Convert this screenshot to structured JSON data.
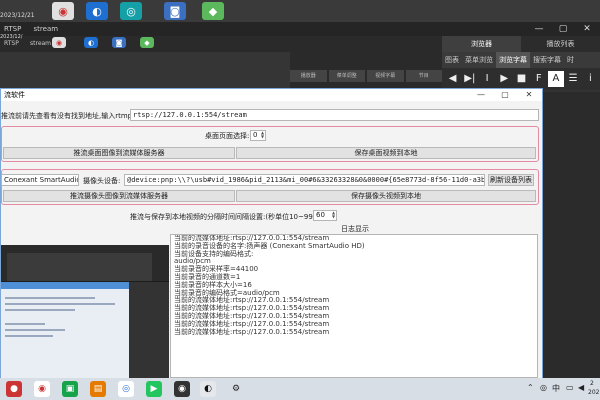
{
  "background": {
    "top_clock": "2023/12/21",
    "top_tabs": [
      "RTSP",
      "stream"
    ],
    "window2_tabs": [
      "RTSP",
      "stream"
    ],
    "window2_clock": "2023/12/",
    "bg2_tabs": [
      "播放器",
      "菜单调整",
      "视频字幕",
      "节目"
    ]
  },
  "player_panel": {
    "tabs": [
      "浏览器",
      "播放列表"
    ],
    "subtabs": [
      "图表",
      "菜单浏览",
      "浏览字幕",
      "搜索字幕",
      "时"
    ],
    "controls": [
      "◀",
      "▶|",
      "I",
      "▶",
      "■",
      "F",
      "A",
      "☰",
      "i"
    ]
  },
  "app": {
    "title": "流软件",
    "url_label": "推流前请先查看有没有找到地址,输入rtmp即可推(推)",
    "url_value": "rtsp://127.0.0.1:554/stream",
    "desktop_label": "桌面页面选择:",
    "desktop_value": "0",
    "btn_push_desktop": "推流桌面图像到流媒体服务器",
    "btn_save_desktop": "保存桌面视频到本地",
    "audio_label": "Conexant SmartAudio HD",
    "camera_label": "摄像头设备:",
    "camera_value": "@device:pnp:\\\\?\\usb#vid_1986&pid_2113&mi_00#6&33263328&0&0000#{65e8773d-8f56-11d0-a3b9-00a0c9223196}\\global",
    "btn_refresh": "刷新设备列表",
    "btn_push_camera": "推流摄像头图像到流媒体服务器",
    "btn_save_camera": "保存摄像头视频到本地",
    "interval_label": "推流与保存到本地视频的分隔时间间隔设置:(秒单位10~9999)",
    "interval_value": "60",
    "log_title": "日志显示",
    "log_lines": [
      "当前的流媒体地址:rtsp://127.0.0.1:554/stream",
      "当前的录音设备的名字:扬声器 (Conexant SmartAudio HD)",
      "当前设备支持的编码格式:",
      "audio/pcm",
      "当前录音的采样率=44100",
      "当前录音的通道数=1",
      "当前录音的样本大小=16",
      "当前录音的编码格式=audio/pcm",
      "当前的流媒体地址:rtsp://127.0.0.1:554/stream",
      "当前的流媒体地址:rtsp://127.0.0.1:554/stream",
      "当前的流媒体地址:rtsp://127.0.0.1:554/stream",
      "当前的流媒体地址:rtsp://127.0.0.1:554/stream",
      "当前的流媒体地址:rtsp://127.0.0.1:554/stream"
    ]
  },
  "taskbar": {
    "tray_lang": "中",
    "clock_line1": "2",
    "clock_line2": "202"
  },
  "colors": {
    "group_border": "#e58aa3",
    "accent": "#4f8fd6"
  }
}
